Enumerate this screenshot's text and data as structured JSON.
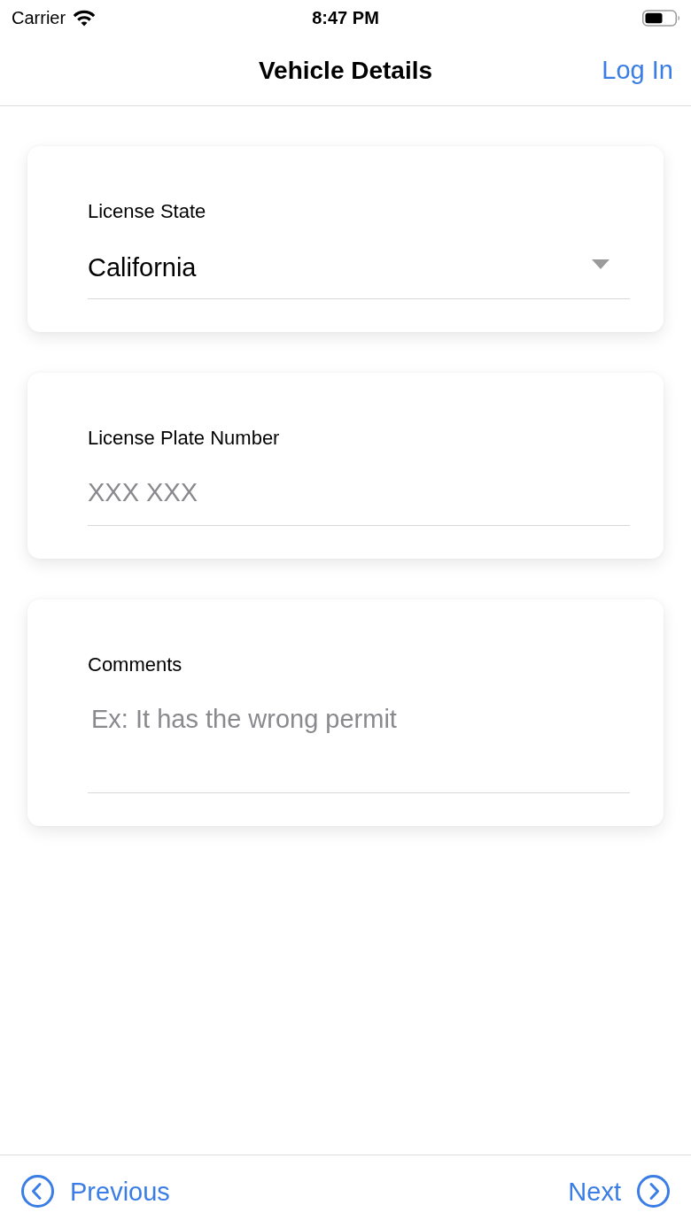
{
  "status_bar": {
    "carrier": "Carrier",
    "time": "8:47 PM"
  },
  "nav_bar": {
    "title": "Vehicle Details",
    "action": "Log In"
  },
  "fields": [
    {
      "kind": "select",
      "label": "License State",
      "value": "California"
    },
    {
      "kind": "text",
      "label": "License Plate Number",
      "placeholder": "XXX XXX"
    },
    {
      "kind": "textarea",
      "label": "Comments",
      "placeholder": "Ex: It has the wrong permit"
    }
  ],
  "footer": {
    "previous": "Previous",
    "next": "Next"
  }
}
